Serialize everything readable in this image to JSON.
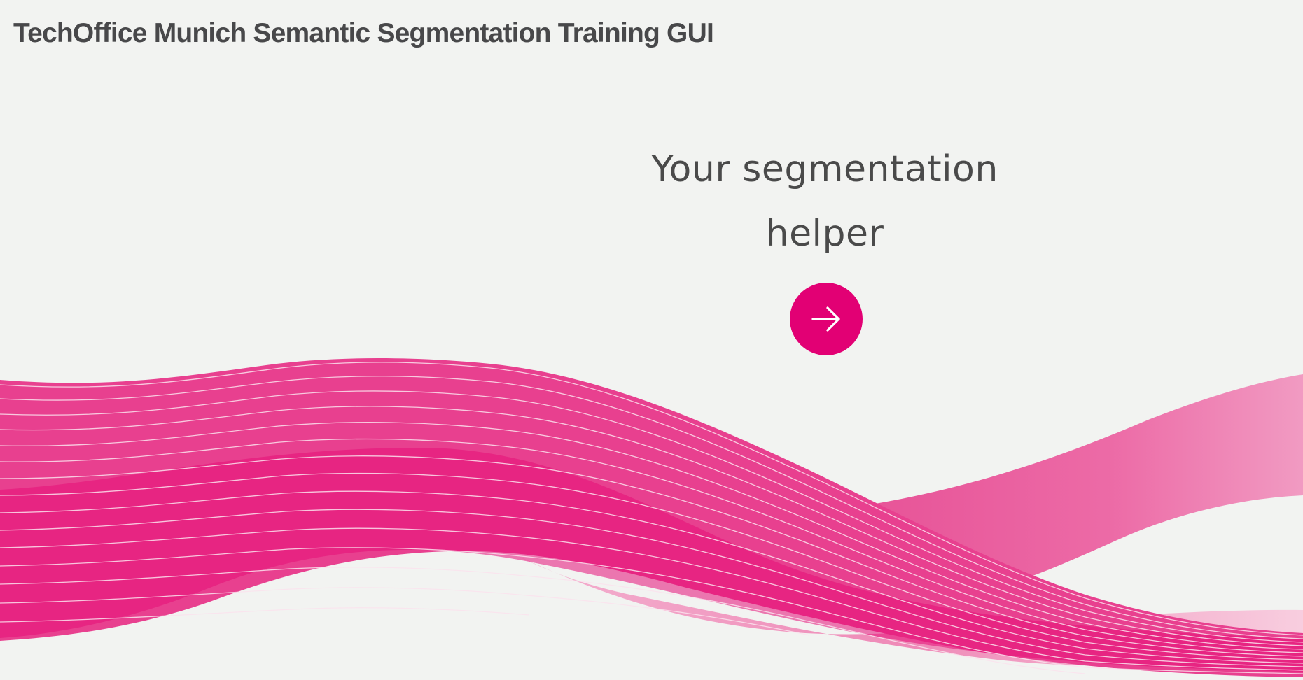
{
  "app": {
    "title": "TechOffice Munich Semantic Segmentation Training GUI"
  },
  "hero": {
    "heading_line1": "Your segmentation",
    "heading_line2": "helper"
  },
  "start_button": {
    "icon": "arrow-right-icon"
  },
  "colors": {
    "background": "#f2f3f1",
    "accent": "#e20074",
    "wave_main": "#e8408f",
    "wave_light": "#f08ab8",
    "title_text": "#48484a",
    "hero_text": "#4a4a4a"
  }
}
